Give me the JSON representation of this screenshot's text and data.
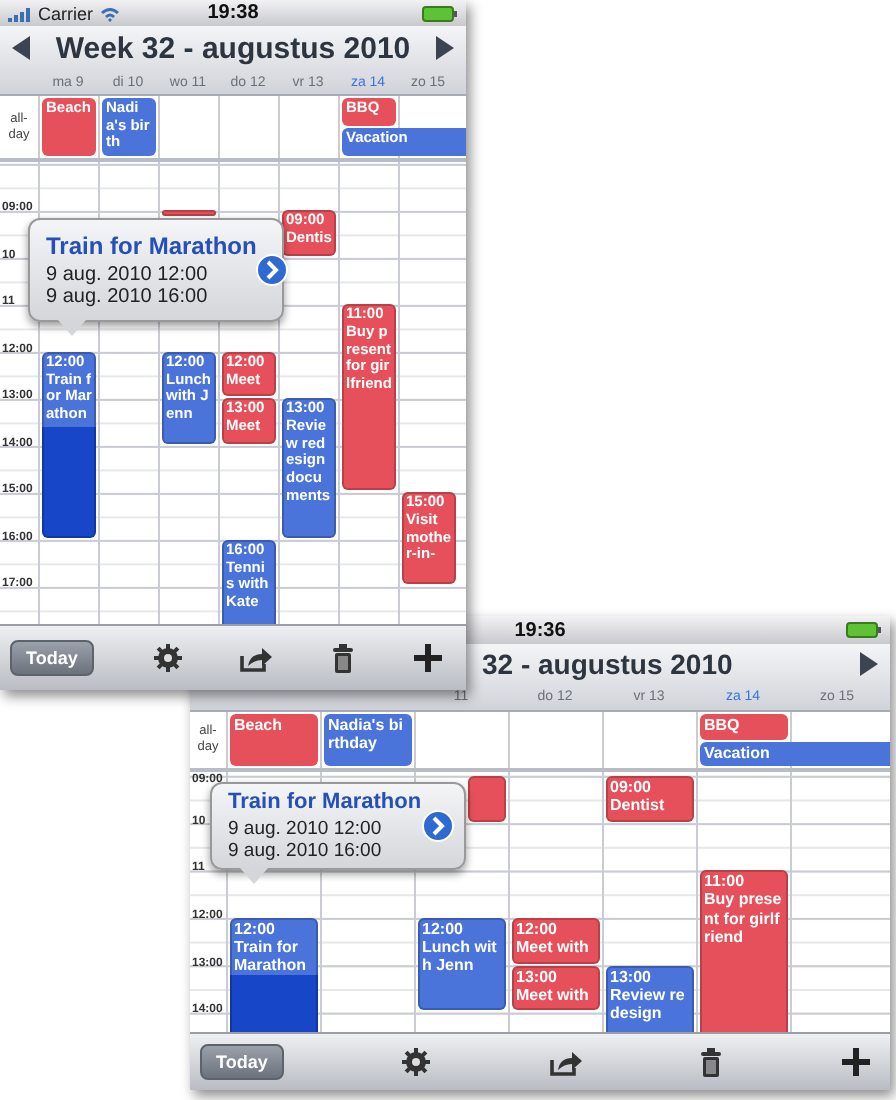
{
  "screens": [
    {
      "kind": "portrait",
      "status_bar": {
        "carrier": "Carrier",
        "time": "19:38"
      },
      "header": {
        "title": "Week 32 - augustus 2010",
        "show_prev": true,
        "show_next": true
      },
      "all_day_label": "all-day",
      "days": [
        {
          "label": "ma 9",
          "today": false,
          "all_day": [
            {
              "title": "Beach",
              "color": "#e6505a"
            }
          ],
          "events": [
            {
              "time": "12:00",
              "title": "Train for Marathon",
              "color": "#4a74d9",
              "selected": true
            }
          ]
        },
        {
          "label": "di 10",
          "today": false,
          "all_day": [
            {
              "title": "Nadia's birth",
              "color": "#4a74d9"
            }
          ]
        },
        {
          "label": "wo 11",
          "today": false,
          "events": [
            {
              "color": "#e6505a",
              "selected": false
            },
            {
              "time": "12:00",
              "title": "Lunch with Jenn",
              "color": "#4a74d9",
              "selected": false
            }
          ]
        },
        {
          "label": "do 12",
          "today": false,
          "events": [
            {
              "time": "12:00",
              "title": "Meet",
              "color": "#e6505a",
              "selected": false
            },
            {
              "time": "13:00",
              "title": "Meet",
              "color": "#e6505a",
              "selected": false
            },
            {
              "time": "16:00",
              "title": "Tennis with Kate",
              "color": "#4a74d9",
              "selected": false
            }
          ]
        },
        {
          "label": "vr 13",
          "today": false,
          "events": [
            {
              "time": "09:00",
              "title": "Dentis",
              "color": "#e6505a",
              "selected": false
            },
            {
              "time": "13:00",
              "title": "Review redesign documents",
              "color": "#4a74d9",
              "selected": false
            }
          ]
        },
        {
          "label": "za 14",
          "today": true,
          "all_day": [
            {
              "title": "BBQ",
              "color": "#e6505a"
            },
            {
              "title": "Vacation",
              "color": "#4a74d9",
              "continues": true
            }
          ],
          "events": [
            {
              "time": "11:00",
              "title": "Buy present for girlfriend",
              "color": "#e6505a",
              "selected": false
            }
          ]
        },
        {
          "label": "zo 15",
          "today": false,
          "events": [
            {
              "time": "15:00",
              "title": "Visit mother-in-",
              "color": "#e6505a",
              "selected": false
            }
          ]
        }
      ],
      "hours": [
        "09:00",
        "10",
        "11",
        "12:00",
        "13:00",
        "14:00",
        "15:00",
        "16:00",
        "17:00"
      ],
      "popup": {
        "title": "Train for Marathon",
        "start": "9 aug. 2010 12:00",
        "end": "9 aug. 2010 16:00"
      },
      "toolbar": {
        "today": "Today"
      }
    },
    {
      "kind": "landscape",
      "status_bar": {
        "time": "19:36"
      },
      "header": {
        "title": "32 - augustus 2010",
        "show_prev": false,
        "show_next": true
      },
      "all_day_label": "all-day",
      "days": [
        {
          "all_day": [
            {
              "title": "Beach",
              "color": "#e6505a"
            }
          ],
          "events": [
            {
              "time": "12:00",
              "title": "Train for Marathon",
              "color": "#4a74d9",
              "selected": true
            }
          ]
        },
        {
          "all_day": [
            {
              "title": "Nadia's birthday",
              "color": "#4a74d9"
            }
          ]
        },
        {
          "label": "11",
          "today": false,
          "events": [
            {
              "color": "#e6505a",
              "selected": false
            },
            {
              "time": "12:00",
              "title": "Lunch with Jenn",
              "color": "#4a74d9",
              "selected": false
            }
          ]
        },
        {
          "label": "do 12",
          "today": false,
          "events": [
            {
              "time": "12:00",
              "title": "Meet with",
              "color": "#e6505a",
              "selected": false
            },
            {
              "time": "13:00",
              "title": "Meet with",
              "color": "#e6505a",
              "selected": false
            }
          ]
        },
        {
          "label": "vr 13",
          "today": false,
          "events": [
            {
              "time": "09:00",
              "title": "Dentist",
              "color": "#e6505a",
              "selected": false
            },
            {
              "time": "13:00",
              "title": "Review redesign",
              "color": "#4a74d9",
              "selected": false
            }
          ]
        },
        {
          "label": "za 14",
          "today": true,
          "all_day": [
            {
              "title": "BBQ",
              "color": "#e6505a"
            },
            {
              "title": "Vacation",
              "color": "#4a74d9",
              "continues": true
            }
          ],
          "events": [
            {
              "time": "11:00",
              "title": "Buy present for girlfriend",
              "color": "#e6505a",
              "selected": false
            }
          ]
        },
        {
          "label": "zo 15",
          "today": false
        }
      ],
      "hours": [
        "09:00",
        "10",
        "11",
        "12:00",
        "13:00",
        "14:00"
      ],
      "popup": {
        "title": "Train for Marathon",
        "start": "9 aug. 2010 12:00",
        "end": "9 aug. 2010 16:00"
      },
      "toolbar": {
        "today": "Today"
      }
    }
  ]
}
